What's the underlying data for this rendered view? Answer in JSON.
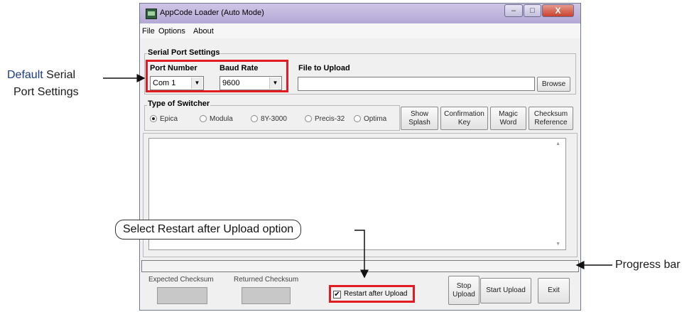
{
  "window": {
    "title": "AppCode Loader (Auto Mode)",
    "min_symbol": "–",
    "max_symbol": "□",
    "close_symbol": "X"
  },
  "menu": [
    "File",
    "Options",
    "About"
  ],
  "serial_port_settings": {
    "group_label": "Serial Port Settings",
    "port_number_label": "Port Number",
    "port_number_value": "Com 1",
    "baud_rate_label": "Baud Rate",
    "baud_rate_value": "9600"
  },
  "file_to_upload": {
    "label": "File to Upload",
    "value": "",
    "browse_label": "Browse"
  },
  "switcher": {
    "group_label": "Type of Switcher",
    "options": [
      "Epica",
      "Modula",
      "8Y-3000",
      "Precis-32",
      "Optima"
    ],
    "selected": "Epica"
  },
  "tool_buttons": [
    {
      "line1": "Show",
      "line2": "Splash"
    },
    {
      "line1": "Confirmation",
      "line2": "Key"
    },
    {
      "line1": "Magic",
      "line2": "Word"
    },
    {
      "line1": "Checksum",
      "line2": "Reference"
    }
  ],
  "log_text": "",
  "progress": 0,
  "checksums": {
    "expected_label": "Expected Checksum",
    "returned_label": "Returned Checksum",
    "expected_value": "",
    "returned_value": ""
  },
  "restart_after_upload": {
    "label": "Restart after Upload",
    "checked": true,
    "check_mark": "✔"
  },
  "actions": {
    "stop_upload_line1": "Stop",
    "stop_upload_line2": "Upload",
    "start_upload": "Start Upload",
    "exit": "Exit"
  },
  "annotations": {
    "default_serial_line1_bold": "Default",
    "default_serial_line1_rest": " Serial",
    "default_serial_line2": "Port Settings",
    "restart_callout": "Select Restart after Upload option",
    "progress_bar": "Progress bar"
  },
  "colors": {
    "highlight_red": "#e21b23",
    "title_bar": "#c4bbe0",
    "annotation_blue": "#1a3a8a"
  }
}
